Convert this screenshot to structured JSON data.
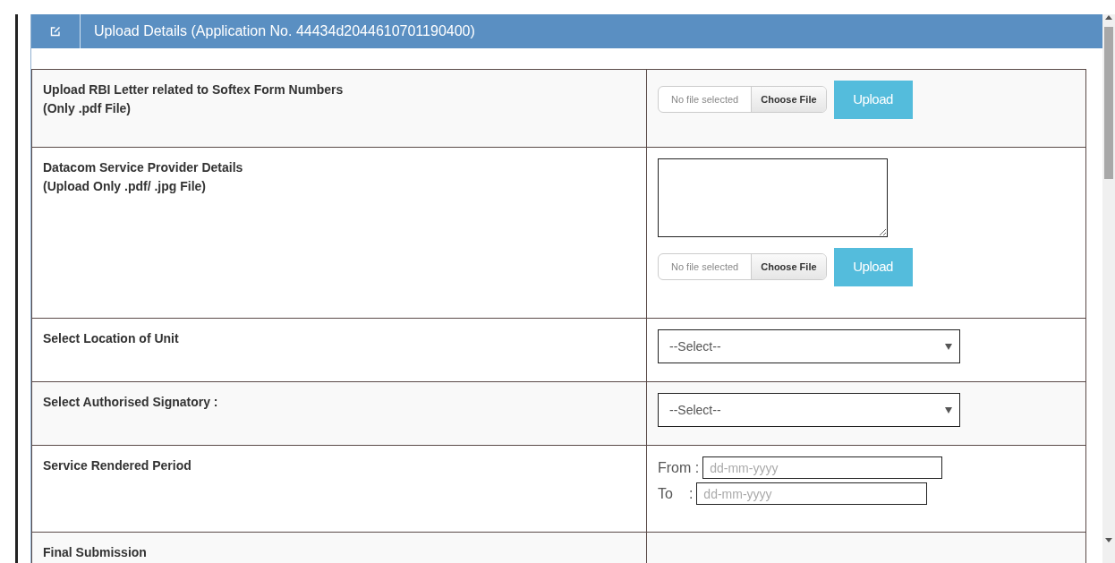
{
  "panel": {
    "title": "Upload Details (Application No. 44434d2044610701190400)"
  },
  "rows": [
    {
      "kind": "upload",
      "label": "Upload RBI Letter related to Softex Form Numbers",
      "note": "(Only .pdf File)",
      "file_status": "No file selected",
      "choose_label": "Choose File",
      "button": "Upload"
    },
    {
      "kind": "textupload",
      "label": "Datacom Service Provider Details",
      "note": "(Upload Only .pdf/ .jpg File)",
      "file_status": "No file selected",
      "choose_label": "Choose File",
      "button": "Upload"
    },
    {
      "kind": "select",
      "label": "Select Location of Unit",
      "value": "--Select--"
    },
    {
      "kind": "select",
      "label": "Select Authorised Signatory :",
      "value": "--Select--"
    },
    {
      "kind": "daterange",
      "label": "Service Rendered Period",
      "from_label": "From :",
      "from_placeholder": "dd-mm-yyyy",
      "to_label": "To",
      "to_sep": ":",
      "to_placeholder": "dd-mm-yyyy"
    },
    {
      "kind": "blank",
      "label": "Final Submission"
    }
  ]
}
